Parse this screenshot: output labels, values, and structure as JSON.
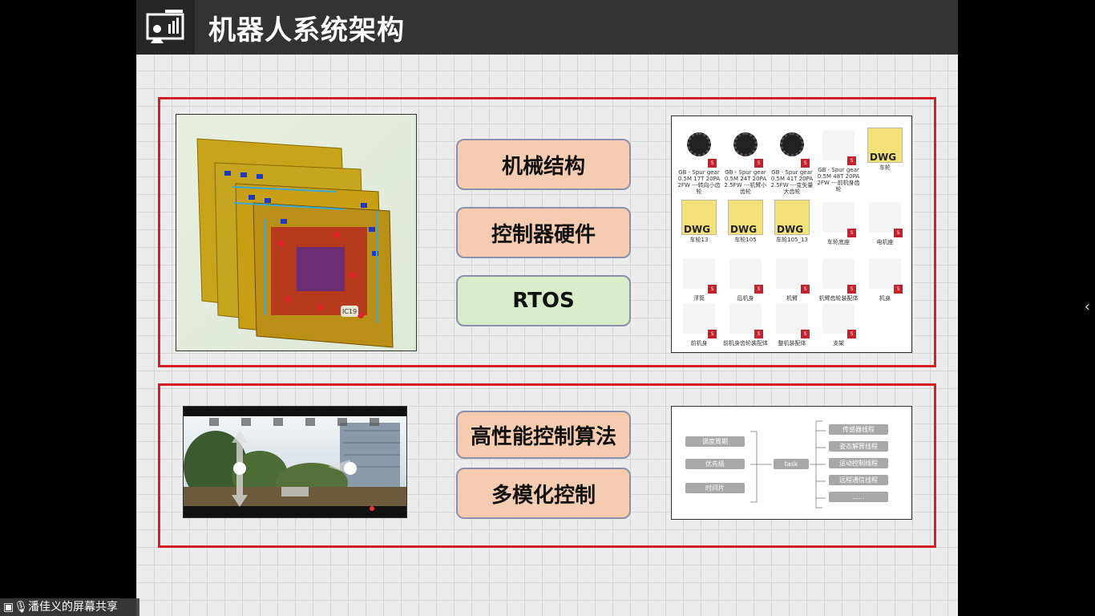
{
  "slide": {
    "title": "机器人系统架构",
    "pills": {
      "mechanical": "机械结构",
      "controller": "控制器硬件",
      "rtos": "RTOS",
      "algorithm": "高性能控制算法",
      "multimodal": "多模化控制"
    },
    "cad": {
      "items": [
        {
          "label": "GB - Spur gear 0.5M 17T 20PA 2FW ---转向小齿轮",
          "kind": "gear"
        },
        {
          "label": "GB - Spur gear 0.5M 24T 20PA 2.5FW ---机臂小齿轮",
          "kind": "gear"
        },
        {
          "label": "GB - Spur gear 0.5M 41T 20PA 2.5FW ---变矢量大齿轮",
          "kind": "gear"
        },
        {
          "label": "GB - Spur gear 0.5M 48T 20PA 2FW ---前机身齿轮",
          "kind": "part"
        },
        {
          "label": "车轮",
          "kind": "dwg"
        },
        {
          "label": "车轮13",
          "kind": "dwg"
        },
        {
          "label": "车轮105",
          "kind": "dwg"
        },
        {
          "label": "车轮105_13",
          "kind": "dwg"
        },
        {
          "label": "车轮底座",
          "kind": "part"
        },
        {
          "label": "电机座",
          "kind": "part"
        },
        {
          "label": "浮筒",
          "kind": "part"
        },
        {
          "label": "后机身",
          "kind": "part"
        },
        {
          "label": "机臂",
          "kind": "part"
        },
        {
          "label": "机臂齿轮装配体",
          "kind": "part"
        },
        {
          "label": "机身",
          "kind": "part"
        },
        {
          "label": "前机身",
          "kind": "part"
        },
        {
          "label": "前机身齿轮装配体",
          "kind": "part"
        },
        {
          "label": "整机装配体",
          "kind": "part"
        },
        {
          "label": "支架",
          "kind": "part"
        }
      ],
      "dwg_text": "DWG",
      "sw_text": "S"
    },
    "flow": {
      "left": [
        "调度周期",
        "优先级",
        "时间片"
      ],
      "center": "task",
      "right": [
        "传感器线程",
        "姿态解算线程",
        "运动控制线程",
        "远程通信线程",
        "......"
      ]
    },
    "pcb_label": "IC19"
  },
  "screen_share": {
    "label": "潘佳义的屏幕共享"
  }
}
